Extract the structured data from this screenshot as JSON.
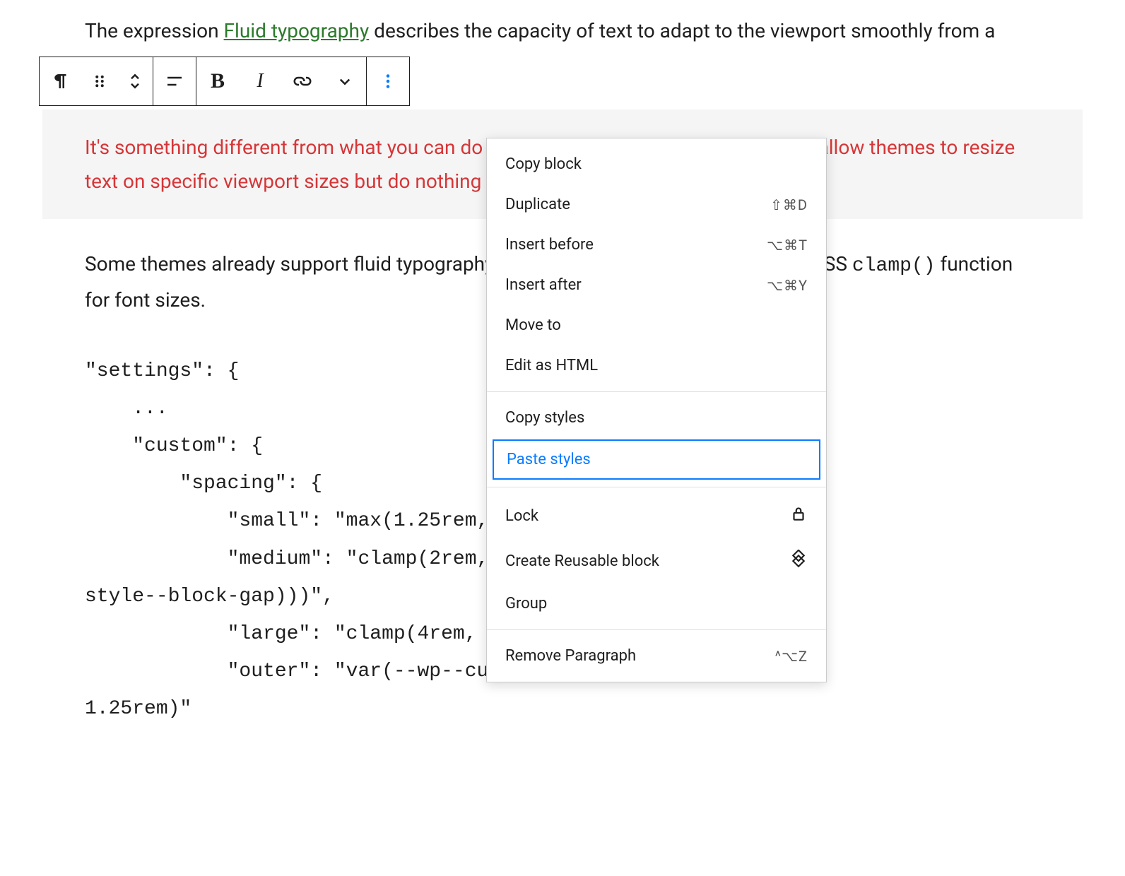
{
  "content": {
    "para1_a": "The expression ",
    "para1_link": "Fluid typography",
    "para1_b": " describes the capacity of text to adapt to the viewport smoothly from a minimum to maximum width.",
    "highlight": "It's something different from what you can do with media queries, as media queries allow themes to resize text on specific viewport sizes but do nothing between different values.",
    "para3_a": "Some themes already support fluid typography. Twenty-Two, for example, uses the CSS ",
    "para3_code": "clamp()",
    "para3_b": " function for font sizes.",
    "code": "\"settings\": {\n    ...\n    \"custom\": {\n        \"spacing\": {\n            \"small\": \"max(1.25rem, 5vw)\",\n            \"medium\": \"clamp(2rem, 8vw, calc(var(--wp--\nstyle--block-gap)))\",\n            \"large\": \"clamp(4rem, 10vw, 8rem)\",\n            \"outer\": \"var(--wp--custom--spacing--small,\n1.25rem)\""
  },
  "menu": {
    "copy_block": "Copy block",
    "duplicate": "Duplicate",
    "duplicate_sc": "⇧⌘D",
    "insert_before": "Insert before",
    "insert_before_sc": "⌥⌘T",
    "insert_after": "Insert after",
    "insert_after_sc": "⌥⌘Y",
    "move_to": "Move to",
    "edit_html": "Edit as HTML",
    "copy_styles": "Copy styles",
    "paste_styles": "Paste styles",
    "lock": "Lock",
    "create_reusable": "Create Reusable block",
    "group": "Group",
    "remove": "Remove Paragraph",
    "remove_sc": "^⌥Z"
  }
}
